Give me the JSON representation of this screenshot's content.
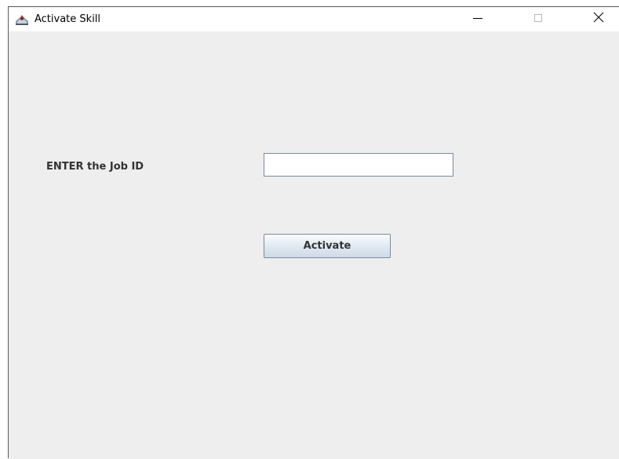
{
  "window": {
    "title": "Activate Skill",
    "app_icon": "java-duke-icon",
    "controls": {
      "minimize_icon": "minimize-icon",
      "maximize_icon": "maximize-icon",
      "close_icon": "close-icon"
    }
  },
  "form": {
    "job_id_label": "ENTER the Job ID",
    "job_id_value": "",
    "job_id_placeholder": "",
    "activate_label": "Activate"
  },
  "colors": {
    "content_background": "#eeeeee",
    "titlebar_background": "#ffffff",
    "label_text": "#333333",
    "input_border": "#7a8a99"
  }
}
